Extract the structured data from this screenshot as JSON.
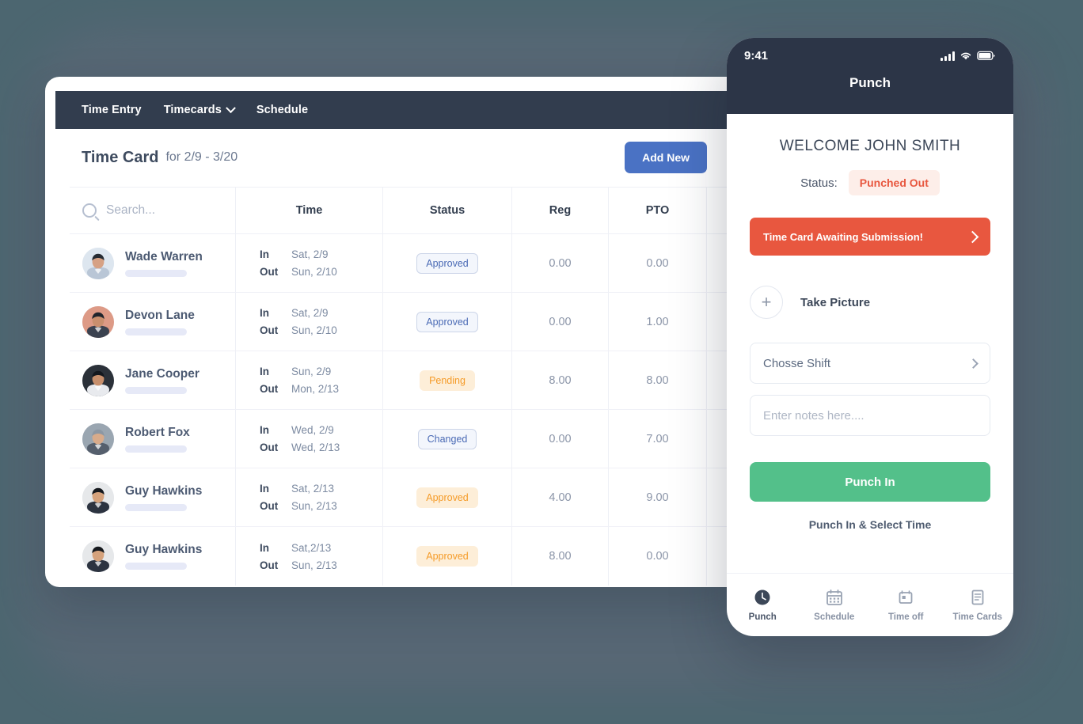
{
  "theme": {
    "page_bg": "#4c6670",
    "nav_bg": "#323d4e",
    "accent_blue": "#4a72c4",
    "accent_green": "#53c08a",
    "accent_red": "#e8573f",
    "badge_orange": "#f59b28",
    "badge_blue": "#4a6ab5"
  },
  "desktop": {
    "nav": {
      "items": [
        {
          "label": "Time Entry",
          "has_caret": false
        },
        {
          "label": "Timecards",
          "has_caret": true
        },
        {
          "label": "Schedule",
          "has_caret": false
        }
      ]
    },
    "header": {
      "title": "Time Card",
      "subtitle": "for 2/9 - 3/20",
      "add_button": "Add New"
    },
    "table": {
      "search_placeholder": "Search...",
      "search_value": "",
      "columns": [
        "Time",
        "Status",
        "Reg",
        "PTO"
      ],
      "rows": [
        {
          "name": "Wade Warren",
          "in_label": "In",
          "in_value": "Sat, 2/9",
          "out_label": "Out",
          "out_value": "Sun, 2/10",
          "status": "Approved",
          "status_style": "blue",
          "reg": "0.00",
          "pto": "0.00"
        },
        {
          "name": "Devon Lane",
          "in_label": "In",
          "in_value": "Sat, 2/9",
          "out_label": "Out",
          "out_value": "Sun, 2/10",
          "status": "Approved",
          "status_style": "blue",
          "reg": "0.00",
          "pto": "1.00"
        },
        {
          "name": "Jane Cooper",
          "in_label": "In",
          "in_value": "Sun, 2/9",
          "out_label": "Out",
          "out_value": "Mon, 2/13",
          "status": "Pending",
          "status_style": "orange",
          "reg": "8.00",
          "pto": "8.00"
        },
        {
          "name": "Robert Fox",
          "in_label": "In",
          "in_value": "Wed, 2/9",
          "out_label": "Out",
          "out_value": "Wed, 2/13",
          "status": "Changed",
          "status_style": "blue",
          "reg": "0.00",
          "pto": "7.00"
        },
        {
          "name": "Guy Hawkins",
          "in_label": "In",
          "in_value": "Sat, 2/13",
          "out_label": "Out",
          "out_value": "Sun, 2/13",
          "status": "Approved",
          "status_style": "orange",
          "reg": "4.00",
          "pto": "9.00"
        },
        {
          "name": "Guy Hawkins",
          "in_label": "In",
          "in_value": "Sat,2/13",
          "out_label": "Out",
          "out_value": "Sun, 2/13",
          "status": "Approved",
          "status_style": "orange",
          "reg": "8.00",
          "pto": "0.00"
        }
      ]
    }
  },
  "phone": {
    "status_bar": {
      "time": "9:41"
    },
    "title": "Punch",
    "welcome": "WELCOME JOHN SMITH",
    "status_label": "Status:",
    "status_value": "Punched Out",
    "alert": "Time Card Awaiting Submission!",
    "take_picture": "Take Picture",
    "choose_shift": "Chosse Shift",
    "notes_placeholder": "Enter notes here....",
    "notes_value": "",
    "punch_in": "Punch In",
    "punch_in_select": "Punch In & Select Time",
    "tabs": [
      {
        "label": "Punch",
        "icon": "clock-icon",
        "active": true
      },
      {
        "label": "Schedule",
        "icon": "calendar-icon",
        "active": false
      },
      {
        "label": "Time off",
        "icon": "calendar-day-icon",
        "active": false
      },
      {
        "label": "Time Cards",
        "icon": "document-icon",
        "active": false
      }
    ]
  }
}
